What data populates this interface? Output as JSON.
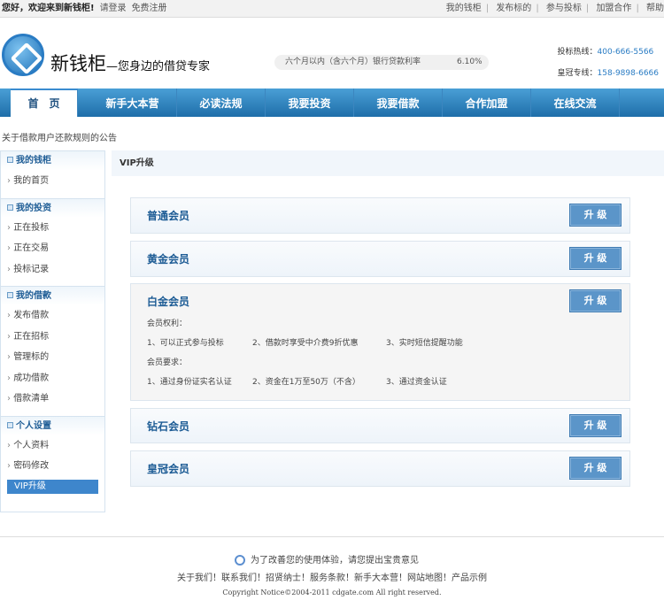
{
  "topbar": {
    "greeting": "您好，欢迎来到新钱柜!",
    "login": "请登录",
    "register": "免费注册",
    "links": [
      "我的钱柜",
      "发布标的",
      "参与投标",
      "加盟合作",
      "帮助"
    ]
  },
  "header": {
    "brand": "新钱柜",
    "slogan": "—您身边的借贷专家",
    "rate_label": "六个月以内（含六个月）银行贷款利率",
    "rate_value": "6.10%",
    "hotline_label": "投标热线：",
    "hotline": "400-666-5566",
    "vip_line_label": "皇冠专线：",
    "vip_line": "158-9898-6666"
  },
  "nav": [
    "首　页",
    "新手大本营",
    "必读法规",
    "我要投资",
    "我要借款",
    "合作加盟",
    "在线交流"
  ],
  "notice": "关于借款用户还款规则的公告",
  "sidebar": [
    {
      "title": "我的钱柜",
      "items": [
        "我的首页"
      ]
    },
    {
      "title": "我的投资",
      "items": [
        "正在投标",
        "正在交易",
        "投标记录"
      ]
    },
    {
      "title": "我的借款",
      "items": [
        "发布借款",
        "正在招标",
        "管理标的",
        "成功借款",
        "借款清单"
      ]
    },
    {
      "title": "个人设置",
      "items": [
        "个人资料",
        "密码修改"
      ],
      "active": "VIP升级"
    }
  ],
  "main": {
    "title": "VIP升级",
    "upgrade_label": "升 级",
    "levels": [
      "普通会员",
      "黄金会员",
      "白金会员",
      "钻石会员",
      "皇冠会员"
    ],
    "platinum": {
      "rights_label": "会员权利：",
      "rights": [
        "1、可以正式参与投标",
        "2、借款时享受中介费9折优惠",
        "3、实时短信提醒功能"
      ],
      "req_label": "会员要求：",
      "reqs": [
        "1、通过身份证实名认证",
        "2、资金在1万至50万（不含）",
        "3、通过资金认证"
      ]
    }
  },
  "footer": {
    "feedback": "为了改善您的使用体验，请您提出宝贵意见",
    "links": "关于我们！联系我们！招贤纳士！服务条款！新手大本营！网站地图！产品示例",
    "copyright": "Copyright Notice©2004-2011 cdgate.com All right reserved."
  }
}
